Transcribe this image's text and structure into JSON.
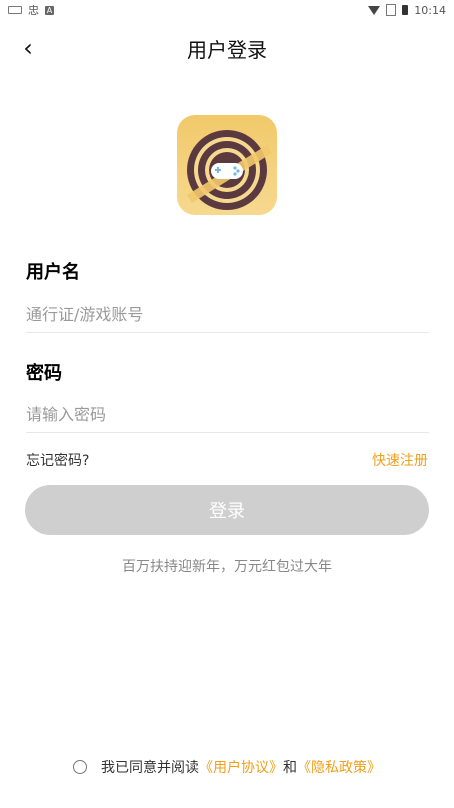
{
  "status_bar": {
    "time": "10:14",
    "app_char": "忠",
    "a_badge": "A",
    "icons": [
      "keyboard-icon",
      "app-icon",
      "a-icon",
      "wifi-icon",
      "sim-icon",
      "battery-icon"
    ]
  },
  "header": {
    "back_icon": "chevron-left-icon",
    "title": "用户登录"
  },
  "logo": {
    "icon": "game-controller-icon",
    "colors": {
      "bg": "#f2c96b",
      "ring": "#5b3a3f",
      "accent": "#f7d37f"
    }
  },
  "form": {
    "username_label": "用户名",
    "username_placeholder": "通行证/游戏账号",
    "password_label": "密码",
    "password_placeholder": "请输入密码"
  },
  "links": {
    "forgot": "忘记密码?",
    "register": "快速注册"
  },
  "login_button": {
    "label": "登录"
  },
  "promo_text": "百万扶持迎新年，万元红包过大年",
  "agreement": {
    "prefix": "我已同意并阅读",
    "user_agreement": "《用户协议》",
    "and": "和",
    "privacy_policy": "《隐私政策》"
  },
  "colors": {
    "accent": "#f0a01c",
    "button_disabled": "#cfcfcf",
    "text": "#111111",
    "muted": "#888888"
  }
}
